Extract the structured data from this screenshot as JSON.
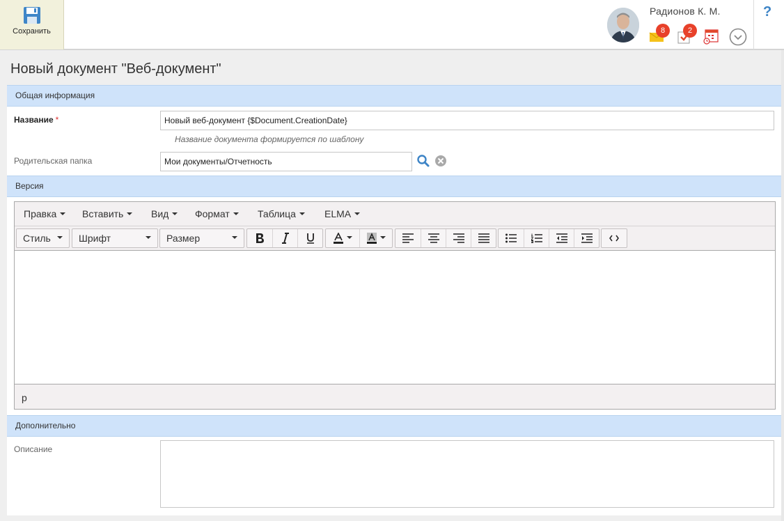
{
  "topbar": {
    "save_label": "Сохранить",
    "user_name": "Радионов К. М.",
    "mail_count": "8",
    "tasks_count": "2",
    "help_label": "?"
  },
  "page": {
    "title": "Новый документ \"Веб-документ\""
  },
  "sections": {
    "general": "Общая информация",
    "version": "Версия",
    "additional": "Дополнительно"
  },
  "fields": {
    "name_label": "Название",
    "name_required": "*",
    "name_value": "Новый веб-документ {$Document.CreationDate}",
    "name_hint": "Название документа формируется по шаблону",
    "parent_label": "Родительская папка",
    "parent_value": "Мои документы/Отчетность",
    "description_label": "Описание"
  },
  "editor": {
    "menu": [
      "Правка",
      "Вставить",
      "Вид",
      "Формат",
      "Таблица",
      "ELMA"
    ],
    "style_label": "Стиль",
    "font_label": "Шрифт",
    "size_label": "Размер",
    "status_path": "p"
  },
  "colors": {
    "section_bg": "#cfe3fa",
    "save_bg": "#f2f1dc",
    "badge": "#e8412a",
    "accent": "#3d84c6"
  }
}
